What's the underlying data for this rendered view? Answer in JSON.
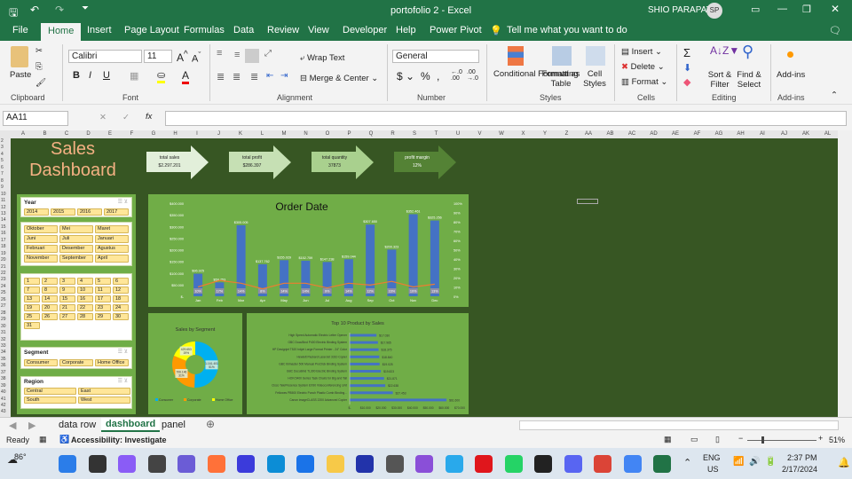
{
  "title": {
    "doc": "portofolio 2  -  Excel",
    "user": "SHIO PARAPAT",
    "initials": "SP"
  },
  "menu": [
    "File",
    "Home",
    "Insert",
    "Page Layout",
    "Formulas",
    "Data",
    "Review",
    "View",
    "Developer",
    "Help",
    "Power Pivot"
  ],
  "tell_me": "Tell me what you want to do",
  "ribbon": {
    "paste": "Paste",
    "font_name": "Calibri",
    "font_size": "11",
    "wrap_text": "Wrap Text",
    "merge_center": "Merge & Center",
    "number_format": "General",
    "conditional": "Conditional Formatting",
    "format_table": "Format as Table",
    "cell_styles": "Cell Styles",
    "insert": "Insert",
    "delete": "Delete",
    "format": "Format",
    "sort_filter": "Sort & Filter",
    "find_select": "Find & Select",
    "addins": "Add-ins",
    "groups": {
      "clipboard": "Clipboard",
      "font": "Font",
      "alignment": "Alignment",
      "number": "Number",
      "styles": "Styles",
      "cells": "Cells",
      "editing": "Editing",
      "addins": "Add-ins"
    }
  },
  "formula_bar": {
    "name_box": "AA11",
    "fx": "fx",
    "value": ""
  },
  "columns": [
    "A",
    "B",
    "C",
    "D",
    "E",
    "F",
    "G",
    "H",
    "I",
    "J",
    "K",
    "L",
    "M",
    "N",
    "O",
    "P",
    "Q",
    "R",
    "S",
    "T",
    "U",
    "V",
    "W",
    "X",
    "Y",
    "Z",
    "AA",
    "AB",
    "AC",
    "AD",
    "AE",
    "AF",
    "AG",
    "AH",
    "AI",
    "AJ",
    "AK",
    "AL"
  ],
  "dashboard": {
    "title_line1": "Sales",
    "title_line2": "Dashboard",
    "kpis": [
      {
        "label": "total sales",
        "value": "$2.297.201",
        "color": "#e2efda"
      },
      {
        "label": "total profit",
        "value": "$286.397",
        "color": "#c6e0b4"
      },
      {
        "label": "total quantity",
        "value": "37873",
        "color": "#a9d08e"
      },
      {
        "label": "profit margin",
        "value": "12%",
        "color": "#548235"
      }
    ],
    "slicers": {
      "year": {
        "title": "Year",
        "items": [
          "2014",
          "2015",
          "2016",
          "2017"
        ]
      },
      "month": {
        "items": [
          "Oktober",
          "Mei",
          "Maret",
          "Juni",
          "Juli",
          "Januari",
          "Februari",
          "Desember",
          "Agustus",
          "November",
          "September",
          "April"
        ]
      },
      "day": {
        "items": [
          "1",
          "2",
          "3",
          "4",
          "5",
          "6",
          "7",
          "8",
          "9",
          "10",
          "11",
          "12",
          "13",
          "14",
          "15",
          "16",
          "17",
          "18",
          "19",
          "20",
          "21",
          "22",
          "23",
          "24",
          "25",
          "26",
          "27",
          "28",
          "29",
          "30",
          "31"
        ]
      },
      "segment": {
        "title": "Segment",
        "items": [
          "Consumer",
          "Corporate",
          "Home Office"
        ]
      },
      "region": {
        "title": "Region",
        "items": [
          "Central",
          "East",
          "South",
          "West"
        ]
      }
    }
  },
  "chart_data": [
    {
      "type": "bar",
      "title": "Order Date",
      "categories": [
        "Jan",
        "Feb",
        "Mar",
        "Apr",
        "May",
        "Jun",
        "Jul",
        "Aug",
        "Sep",
        "Oct",
        "Nov",
        "Dec"
      ],
      "series": [
        {
          "name": "Sales",
          "values": [
            96925,
            59753,
            305005,
            137762,
            155029,
            152759,
            147238,
            159044,
            307650,
            200323,
            352461,
            325256
          ],
          "labels": [
            "$96.925",
            "$59.753",
            "$305.005",
            "$137.762",
            "$155.029",
            "$152.759",
            "$147.238",
            "$159.044",
            "$307.650",
            "$200.323",
            "$352.461",
            "$325.256"
          ]
        },
        {
          "name": "Profit margin",
          "type": "line",
          "values": [
            10,
            17,
            14,
            8,
            14,
            14,
            9,
            14,
            12,
            16,
            10,
            13
          ],
          "labels": [
            "10%",
            "17%",
            "14%",
            "8%",
            "14%",
            "14%",
            "9%",
            "14%",
            "12%",
            "16%",
            "10%",
            "13%"
          ]
        }
      ],
      "ylim": [
        0,
        400000
      ],
      "yticks": [
        "$-",
        "$50.000",
        "$100.000",
        "$150.000",
        "$200.000",
        "$250.000",
        "$300.000",
        "$350.000",
        "$400.000"
      ],
      "y2ticks": [
        "0%",
        "10%",
        "20%",
        "30%",
        "40%",
        "50%",
        "60%",
        "70%",
        "80%",
        "90%",
        "100%"
      ]
    },
    {
      "type": "pie",
      "title": "Sales by Segment",
      "categories": [
        "Consumer",
        "Corporate",
        "Home Office"
      ],
      "values": [
        1161401,
        706146,
        429653
      ],
      "labels": [
        "1.161.401\n51%",
        "706.146\n31%",
        "429.653\n19%"
      ],
      "colors": [
        "#00b0f0",
        "#ff9900",
        "#ffff00"
      ],
      "legend": "bottom"
    },
    {
      "type": "bar",
      "title": "Top 10 Product by Sales",
      "categories": [
        "High Speed Automatic Electric Letter Opener",
        "GBC DocuBind P400 Electric Binding System",
        "HP Designjet T520 Inkjet Large Format Printer - 24\" Color",
        "Hewlett Packard LaserJet 3310 Copier",
        "GBC Ibimaster 500 Manual ProClick Binding System",
        "GBC DocuBind TL300 Electric Binding System",
        "HON 5400 Series Task Chairs for Big and Tall",
        "Cisco TelePresence System EX90 Videoconferencing Unit",
        "Fellowes PB500 Electric Punch Plastic Comb Binding...",
        "Canon imageCLASS 2200 Advanced Copier"
      ],
      "values": [
        17030,
        17965,
        18375,
        18840,
        19025,
        19823,
        21871,
        22638,
        27453,
        61600
      ],
      "labels": [
        "$17.030",
        "$17.965",
        "$18.375",
        "$18.840",
        "$19.025",
        "$19.823",
        "$21.871",
        "$22.638",
        "$27.453",
        "$61.600"
      ],
      "xlim": [
        0,
        70000
      ],
      "xticks": [
        "$-",
        "$10.000",
        "$20.000",
        "$30.000",
        "$40.000",
        "$50.000",
        "$60.000",
        "$70.000"
      ]
    }
  ],
  "sheet_tabs": [
    "data row",
    "dashboard",
    "panel"
  ],
  "status": {
    "ready": "Ready",
    "accessibility": "Accessibility: Investigate",
    "zoom": "51%"
  },
  "taskbar": {
    "weather": "86°",
    "lang1": "ENG",
    "lang2": "US",
    "time": "2:37 PM",
    "date": "2/17/2024"
  }
}
